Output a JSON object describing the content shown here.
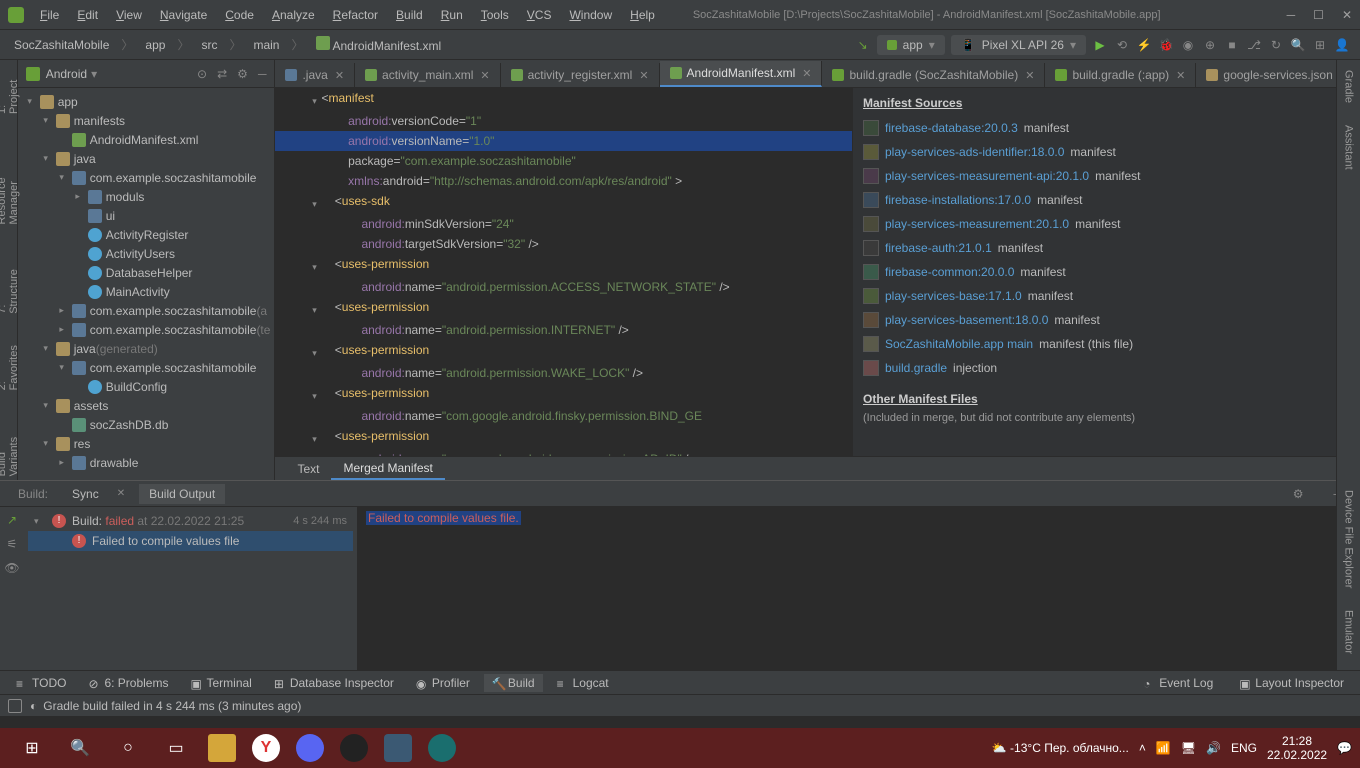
{
  "window": {
    "title": "SocZashitaMobile [D:\\Projects\\SocZashitaMobile] - AndroidManifest.xml [SocZashitaMobile.app]"
  },
  "menu": [
    "File",
    "Edit",
    "View",
    "Navigate",
    "Code",
    "Analyze",
    "Refactor",
    "Build",
    "Run",
    "Tools",
    "VCS",
    "Window",
    "Help"
  ],
  "breadcrumbs": [
    "SocZashitaMobile",
    "app",
    "src",
    "main",
    "AndroidManifest.xml"
  ],
  "runConfig": {
    "app": "app",
    "device": "Pixel XL API 26"
  },
  "treeHeader": "Android",
  "tree": [
    {
      "indent": 0,
      "arrow": "▾",
      "icon": "folder",
      "label": "app"
    },
    {
      "indent": 1,
      "arrow": "▾",
      "icon": "folder",
      "label": "manifests"
    },
    {
      "indent": 2,
      "arrow": "",
      "icon": "xml",
      "label": "AndroidManifest.xml"
    },
    {
      "indent": 1,
      "arrow": "▾",
      "icon": "folder",
      "label": "java"
    },
    {
      "indent": 2,
      "arrow": "▾",
      "icon": "pkg",
      "label": "com.example.soczashitamobile"
    },
    {
      "indent": 3,
      "arrow": "▸",
      "icon": "pkg",
      "label": "moduls"
    },
    {
      "indent": 3,
      "arrow": "",
      "icon": "pkg",
      "label": "ui"
    },
    {
      "indent": 3,
      "arrow": "",
      "icon": "cls",
      "label": "ActivityRegister"
    },
    {
      "indent": 3,
      "arrow": "",
      "icon": "cls",
      "label": "ActivityUsers"
    },
    {
      "indent": 3,
      "arrow": "",
      "icon": "cls",
      "label": "DatabaseHelper"
    },
    {
      "indent": 3,
      "arrow": "",
      "icon": "cls",
      "label": "MainActivity"
    },
    {
      "indent": 2,
      "arrow": "▸",
      "icon": "pkg",
      "label": "com.example.soczashitamobile",
      "dim": " (a"
    },
    {
      "indent": 2,
      "arrow": "▸",
      "icon": "pkg",
      "label": "com.example.soczashitamobile",
      "dim": " (te"
    },
    {
      "indent": 1,
      "arrow": "▾",
      "icon": "folder",
      "label": "java",
      "dim": " (generated)"
    },
    {
      "indent": 2,
      "arrow": "▾",
      "icon": "pkg",
      "label": "com.example.soczashitamobile"
    },
    {
      "indent": 3,
      "arrow": "",
      "icon": "cls",
      "label": "BuildConfig"
    },
    {
      "indent": 1,
      "arrow": "▾",
      "icon": "folder",
      "label": "assets"
    },
    {
      "indent": 2,
      "arrow": "",
      "icon": "db",
      "label": "socZashDB.db"
    },
    {
      "indent": 1,
      "arrow": "▾",
      "icon": "folder",
      "label": "res"
    },
    {
      "indent": 2,
      "arrow": "▸",
      "icon": "pkg",
      "label": "drawable"
    }
  ],
  "tabs": [
    {
      "label": ".java",
      "icon": "#5a7896"
    },
    {
      "label": "activity_main.xml",
      "icon": "#6e9e4f"
    },
    {
      "label": "activity_register.xml",
      "icon": "#6e9e4f"
    },
    {
      "label": "AndroidManifest.xml",
      "icon": "#6e9e4f",
      "active": true
    },
    {
      "label": "build.gradle (SocZashitaMobile)",
      "icon": "#689f38"
    },
    {
      "label": "build.gradle (:app)",
      "icon": "#689f38"
    },
    {
      "label": "google-services.json",
      "icon": "#a8915d"
    }
  ],
  "code": [
    {
      "fold": "▾",
      "t": [
        {
          "c": "c-op",
          "s": "<"
        },
        {
          "c": "c-tag",
          "s": "manifest"
        }
      ]
    },
    {
      "t": [
        {
          "c": "c-ns",
          "s": "        android:"
        },
        {
          "c": "c-attr",
          "s": "versionCode="
        },
        {
          "c": "c-str",
          "s": "\"1\""
        }
      ]
    },
    {
      "hl": true,
      "t": [
        {
          "c": "c-ns",
          "s": "        android:"
        },
        {
          "c": "c-attr",
          "s": "versionName="
        },
        {
          "c": "c-str",
          "s": "\"1.0\""
        }
      ]
    },
    {
      "t": [
        {
          "c": "c-attr",
          "s": "        package="
        },
        {
          "c": "c-str",
          "s": "\"com.example.soczashitamobile\""
        }
      ]
    },
    {
      "t": [
        {
          "c": "c-ns",
          "s": "        xmlns:"
        },
        {
          "c": "c-attr",
          "s": "android="
        },
        {
          "c": "c-str",
          "s": "\"http://schemas.android.com/apk/res/android\""
        },
        {
          "c": "c-op",
          "s": " >"
        }
      ]
    },
    {
      "fold": "▾",
      "t": [
        {
          "c": "c-op",
          "s": "    <"
        },
        {
          "c": "c-tag",
          "s": "uses-sdk"
        }
      ]
    },
    {
      "t": [
        {
          "c": "c-ns",
          "s": "            android:"
        },
        {
          "c": "c-attr",
          "s": "minSdkVersion="
        },
        {
          "c": "c-str",
          "s": "\"24\""
        }
      ]
    },
    {
      "t": [
        {
          "c": "c-ns",
          "s": "            android:"
        },
        {
          "c": "c-attr",
          "s": "targetSdkVersion="
        },
        {
          "c": "c-str",
          "s": "\"32\""
        },
        {
          "c": "c-op",
          "s": " />"
        }
      ]
    },
    {
      "fold": "▾",
      "t": [
        {
          "c": "c-op",
          "s": "    <"
        },
        {
          "c": "c-tag",
          "s": "uses-permission"
        }
      ]
    },
    {
      "t": [
        {
          "c": "c-ns",
          "s": "            android:"
        },
        {
          "c": "c-attr",
          "s": "name="
        },
        {
          "c": "c-str",
          "s": "\"android.permission.ACCESS_NETWORK_STATE\""
        },
        {
          "c": "c-op",
          "s": " />"
        }
      ]
    },
    {
      "fold": "▾",
      "t": [
        {
          "c": "c-op",
          "s": "    <"
        },
        {
          "c": "c-tag",
          "s": "uses-permission"
        }
      ]
    },
    {
      "t": [
        {
          "c": "c-ns",
          "s": "            android:"
        },
        {
          "c": "c-attr",
          "s": "name="
        },
        {
          "c": "c-str",
          "s": "\"android.permission.INTERNET\""
        },
        {
          "c": "c-op",
          "s": " />"
        }
      ]
    },
    {
      "fold": "▾",
      "t": [
        {
          "c": "c-op",
          "s": "    <"
        },
        {
          "c": "c-tag",
          "s": "uses-permission"
        }
      ]
    },
    {
      "t": [
        {
          "c": "c-ns",
          "s": "            android:"
        },
        {
          "c": "c-attr",
          "s": "name="
        },
        {
          "c": "c-str",
          "s": "\"android.permission.WAKE_LOCK\""
        },
        {
          "c": "c-op",
          "s": " />"
        }
      ]
    },
    {
      "fold": "▾",
      "t": [
        {
          "c": "c-op",
          "s": "    <"
        },
        {
          "c": "c-tag",
          "s": "uses-permission"
        }
      ]
    },
    {
      "t": [
        {
          "c": "c-ns",
          "s": "            android:"
        },
        {
          "c": "c-attr",
          "s": "name="
        },
        {
          "c": "c-str",
          "s": "\"com.google.android.finsky.permission.BIND_GE"
        }
      ]
    },
    {
      "fold": "▾",
      "t": [
        {
          "c": "c-op",
          "s": "    <"
        },
        {
          "c": "c-tag",
          "s": "uses-permission"
        }
      ]
    },
    {
      "t": [
        {
          "c": "c-ns",
          "s": "            android:"
        },
        {
          "c": "c-attr",
          "s": "name="
        },
        {
          "c": "c-str",
          "s": "\"com.google.android.gms.permission.AD_ID\""
        },
        {
          "c": "c-op",
          "s": " />"
        }
      ]
    }
  ],
  "manifest": {
    "title": "Manifest Sources",
    "sources": [
      {
        "sw": "#3a4a3a",
        "link": "firebase-database:20.0.3",
        "suf": " manifest"
      },
      {
        "sw": "#5a5a3a",
        "link": "play-services-ads-identifier:18.0.0",
        "suf": " manifest"
      },
      {
        "sw": "#4a3a4a",
        "link": "play-services-measurement-api:20.1.0",
        "suf": " manifest"
      },
      {
        "sw": "#3a4a5a",
        "link": "firebase-installations:17.0.0",
        "suf": " manifest"
      },
      {
        "sw": "#4a4a3a",
        "link": "play-services-measurement:20.1.0",
        "suf": " manifest"
      },
      {
        "sw": "#3a3a3a",
        "link": "firebase-auth:21.0.1",
        "suf": " manifest"
      },
      {
        "sw": "#3a5a4a",
        "link": "firebase-common:20.0.0",
        "suf": " manifest"
      },
      {
        "sw": "#4a5a3a",
        "link": "play-services-base:17.1.0",
        "suf": " manifest"
      },
      {
        "sw": "#5a4a3a",
        "link": "play-services-basement:18.0.0",
        "suf": " manifest"
      },
      {
        "sw": "#5a5a4a",
        "link": "SocZashitaMobile.app main",
        "suf": " manifest (this file)"
      },
      {
        "sw": "#6a4a4a",
        "link": "build.gradle",
        "suf": " injection"
      }
    ],
    "otherTitle": "Other Manifest Files",
    "otherSub": "(Included in merge, but did not contribute any elements)"
  },
  "editorFooter": {
    "text": "Text",
    "merged": "Merged Manifest"
  },
  "buildTabs": {
    "label": "Build:",
    "sync": "Sync",
    "output": "Build Output"
  },
  "buildTree": [
    {
      "indent": 0,
      "arrow": "▾",
      "err": true,
      "label": "Build: ",
      "st": "failed",
      "dim": " at 22.02.2022 21:25",
      "time": "4 s 244 ms"
    },
    {
      "indent": 1,
      "arrow": "",
      "err": true,
      "label": "Failed to compile values file",
      "sel": true
    }
  ],
  "buildOutput": "Failed to compile values file.",
  "bottomTabs": [
    {
      "label": "TODO",
      "icon": "≡"
    },
    {
      "label": "6: Problems",
      "icon": "⊘"
    },
    {
      "label": "Terminal",
      "icon": "▣"
    },
    {
      "label": "Database Inspector",
      "icon": "⊞"
    },
    {
      "label": "Profiler",
      "icon": "◉"
    },
    {
      "label": "Build",
      "icon": "🔨",
      "active": true
    },
    {
      "label": "Logcat",
      "icon": "≡"
    }
  ],
  "bottomRight": [
    {
      "label": "Event Log",
      "icon": "◔"
    },
    {
      "label": "Layout Inspector",
      "icon": "▣"
    }
  ],
  "statusBar": "Gradle build failed in 4 s 244 ms (3 minutes ago)",
  "taskbar": {
    "weather": "-13°C  Пер. облачно...",
    "lang": "ENG",
    "time": "21:28",
    "date": "22.02.2022"
  }
}
